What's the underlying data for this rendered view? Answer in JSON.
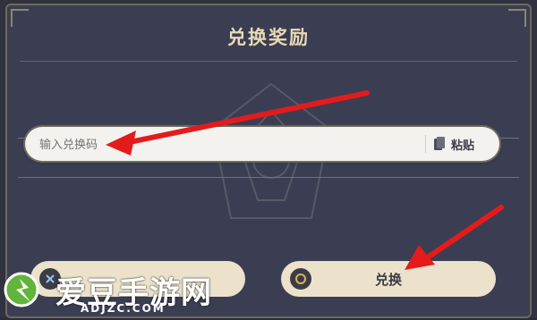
{
  "dialog": {
    "title": "兑换奖励",
    "input_placeholder": "输入兑换码",
    "paste_label": "粘贴",
    "confirm_label": "兑换"
  },
  "watermark": {
    "logo_text": "爱豆手游网",
    "domain": "ADJZC.COM"
  },
  "colors": {
    "arrow": "#e31b1b",
    "panel_bg": "#3b3e52",
    "button_bg": "#ece2cb",
    "title": "#e7d9b6"
  }
}
